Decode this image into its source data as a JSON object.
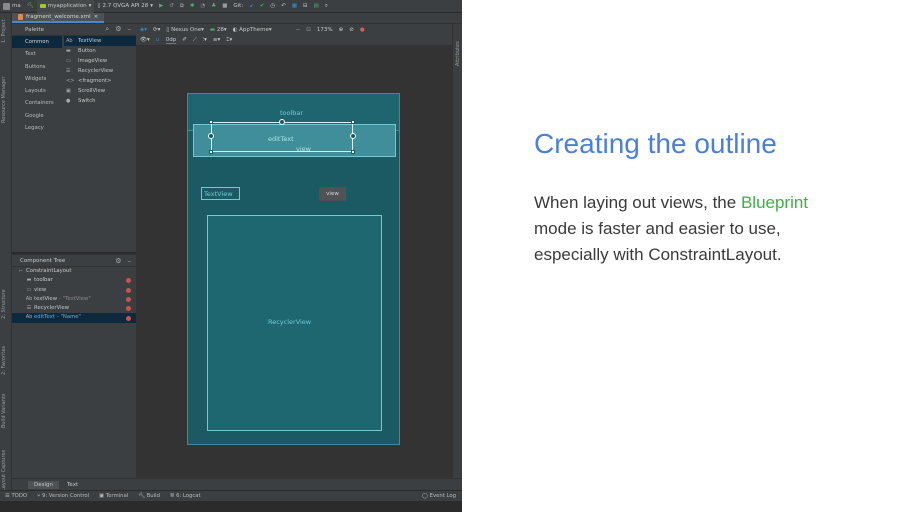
{
  "toolbar": {
    "project": "ma",
    "module": "myapplication",
    "device_config": "2.7  QVGA API 28",
    "git_label": "Git:"
  },
  "editor_tab": {
    "label": "fragment_welcome.xml"
  },
  "side_tools": {
    "left": [
      "1: Project",
      "Resource Manager",
      "2: Structure",
      "2: Favorites",
      "Build Variants",
      "Layout Captures"
    ],
    "right": [
      "Attributes"
    ]
  },
  "palette": {
    "title": "Palette",
    "categories": [
      "Common",
      "Text",
      "Buttons",
      "Widgets",
      "Layouts",
      "Containers",
      "Google",
      "Legacy"
    ],
    "selected_category": "Common",
    "items": [
      {
        "icon": "Ab",
        "label": "TextView"
      },
      {
        "icon": "▬",
        "label": "Button"
      },
      {
        "icon": "▭",
        "label": "ImageView"
      },
      {
        "icon": "☰",
        "label": "RecyclerView"
      },
      {
        "icon": "<>",
        "label": "<fragment>"
      },
      {
        "icon": "▣",
        "label": "ScrollView"
      },
      {
        "icon": "●",
        "label": "Switch"
      }
    ]
  },
  "design_toolbar": {
    "device": "Nexus One",
    "api": "28",
    "theme": "AppTheme",
    "zoom": "173%",
    "margin": "0dp"
  },
  "component_tree": {
    "title": "Component Tree",
    "nodes": [
      {
        "icon": "⌐",
        "label": "ConstraintLayout",
        "hint": "",
        "level": 0,
        "error": false
      },
      {
        "icon": "▬",
        "label": "toolbar",
        "hint": "",
        "level": 1,
        "error": true
      },
      {
        "icon": "▭",
        "label": "view",
        "hint": "",
        "level": 1,
        "error": true
      },
      {
        "icon": "Ab",
        "label": "textView",
        "hint": "- \"TextView\"",
        "level": 1,
        "error": true
      },
      {
        "icon": "☰",
        "label": "RecyclerView",
        "hint": "",
        "level": 1,
        "error": true
      },
      {
        "icon": "Ab",
        "label": "editText",
        "hint": "- \"Name\"",
        "level": 1,
        "error": true
      }
    ],
    "selected": "editText"
  },
  "blueprint": {
    "toolbar_label": "toolbar",
    "edittext_label": "editText",
    "view_tooltip": "view",
    "view_label": "view",
    "textview_label": "TextView",
    "recycler_label": "RecyclerView"
  },
  "mode_tabs": [
    "Design",
    "Text"
  ],
  "status_bar": {
    "items": [
      "TODO",
      "9: Version Control",
      "Terminal",
      "Build",
      "6: Logcat"
    ],
    "right": "Event Log"
  },
  "slide": {
    "title": "Creating the outline",
    "body_before": "When laying out views, the ",
    "highlight": "Blueprint",
    "body_after": " mode is faster and easier to use, especially with ConstraintLayout.",
    "title_color": "#4a80d8",
    "highlight_color": "#3fae49"
  }
}
